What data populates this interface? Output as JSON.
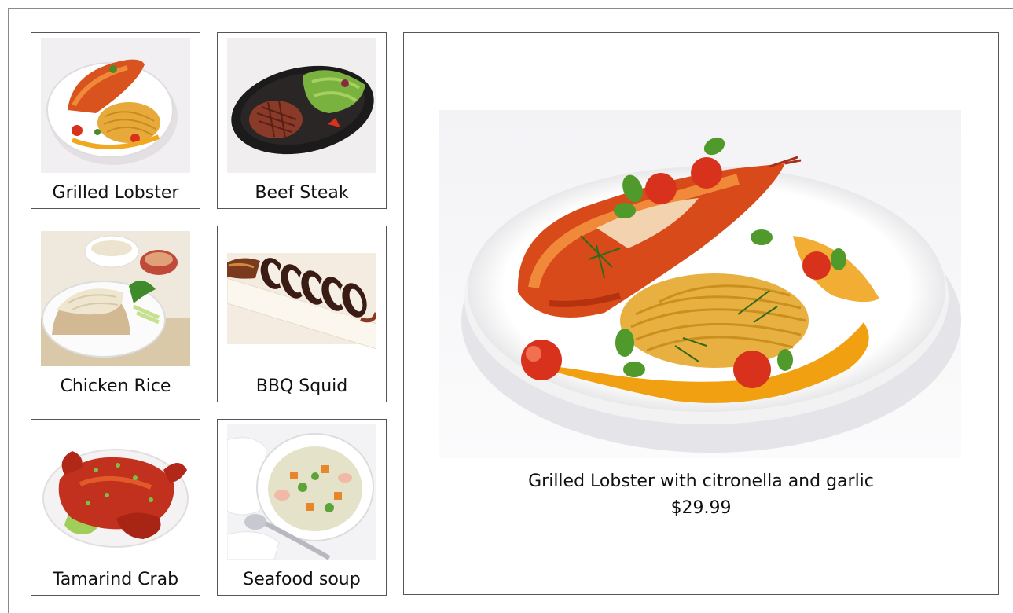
{
  "menu": {
    "items": [
      {
        "label": "Grilled Lobster",
        "image": "lobster-dish-icon"
      },
      {
        "label": "Beef Steak",
        "image": "steak-dish-icon"
      },
      {
        "label": "Chicken Rice",
        "image": "chicken-rice-dish-icon"
      },
      {
        "label": "BBQ Squid",
        "image": "squid-dish-icon"
      },
      {
        "label": "Tamarind Crab",
        "image": "crab-dish-icon"
      },
      {
        "label": "Seafood soup",
        "image": "soup-dish-icon"
      }
    ]
  },
  "detail": {
    "name": "Grilled Lobster with citronella and garlic",
    "price": "$29.99",
    "image": "lobster-dish-icon"
  },
  "colors": {
    "border": "#555555",
    "window_border": "#8a8a8a",
    "background": "#ffffff",
    "text": "#111111"
  }
}
